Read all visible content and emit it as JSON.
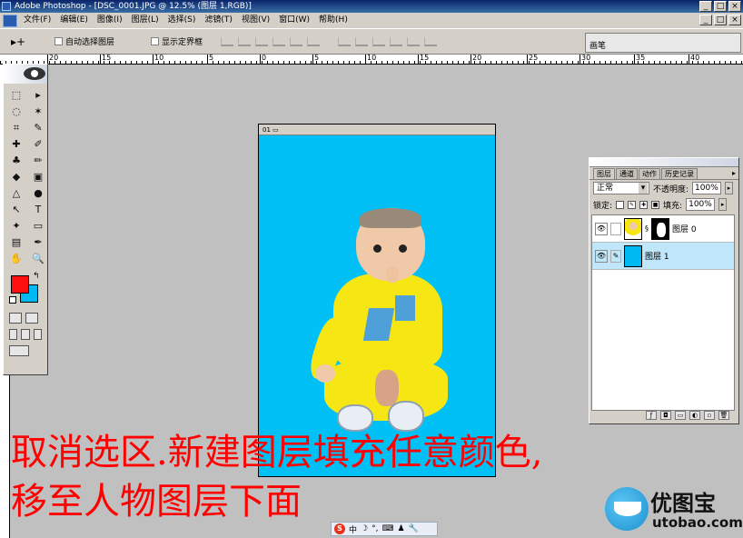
{
  "window": {
    "title": "Adobe Photoshop - [DSC_0001.JPG @ 12.5% (图层 1,RGB)]",
    "buttons": [
      "_",
      "□",
      "×"
    ]
  },
  "menu": {
    "items": [
      "文件(F)",
      "编辑(E)",
      "图像(I)",
      "图层(L)",
      "选择(S)",
      "滤镜(T)",
      "视图(V)",
      "窗口(W)",
      "帮助(H)"
    ]
  },
  "options": {
    "tool_preset": "▸+",
    "auto_select": "自动选择图层",
    "show_bounds": "显示定界框",
    "brush_tab": "画笔"
  },
  "ruler": {
    "ticks": [
      "20",
      "15",
      "10",
      "5",
      "0",
      "5",
      "10",
      "15",
      "20",
      "25",
      "30",
      "35",
      "40"
    ]
  },
  "toolbox": {
    "tools": [
      "⬚",
      "▸",
      "◌",
      "✶",
      "⌗",
      "✎",
      "✚",
      "✐",
      "♣",
      "✏",
      "◆",
      "▣",
      "△",
      "●",
      "↖",
      "T",
      "✦",
      "▭",
      "▤",
      "✒",
      "✋",
      "🔍"
    ],
    "foreground_color": "#ff1010",
    "background_color": "#00b8f2"
  },
  "document": {
    "title": "01 ▭"
  },
  "layers_panel": {
    "tabs": [
      "图层",
      "通道",
      "动作",
      "历史记录"
    ],
    "blend_mode": "正常",
    "opacity_label": "不透明度:",
    "opacity_value": "100%",
    "lock_label": "锁定:",
    "fill_label": "填充:",
    "fill_value": "100%",
    "layers": [
      {
        "name": "图层 0",
        "selected": false,
        "has_mask": true
      },
      {
        "name": "图层 1",
        "selected": true,
        "has_mask": false
      }
    ]
  },
  "caption": {
    "line1": "取消选区.新建图层填充任意颜色,",
    "line2": "移至人物图层下面",
    "color": "#ff0000"
  },
  "ime": {
    "logo": "S",
    "label": "中"
  },
  "watermark": {
    "cn": "优图宝",
    "en": "utobao.com"
  }
}
